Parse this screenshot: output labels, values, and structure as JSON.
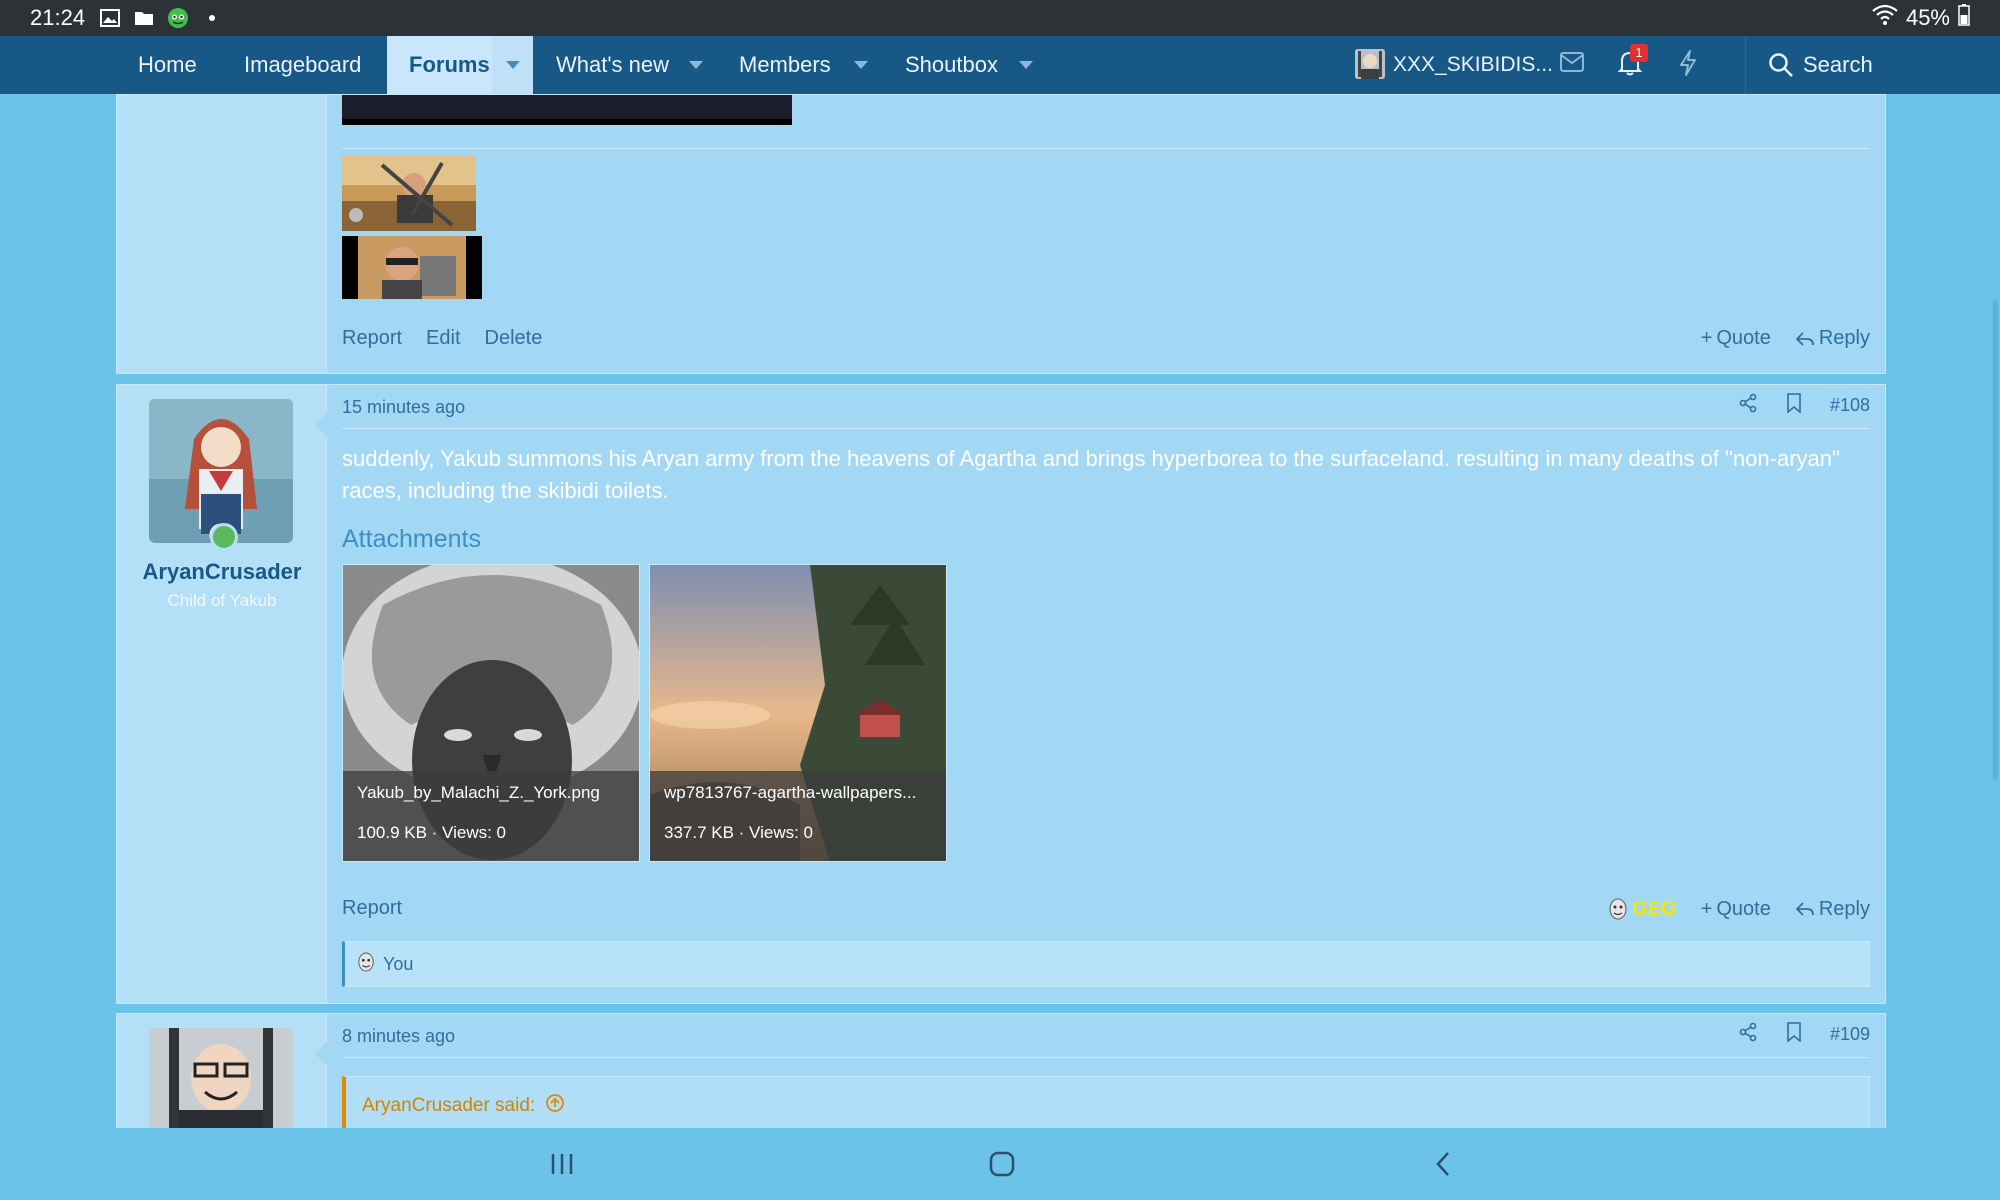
{
  "status_bar": {
    "time": "21:24",
    "icons": [
      "gallery-icon",
      "folder-icon",
      "app-icon",
      "dot-icon"
    ],
    "battery": "45%"
  },
  "nav": {
    "items": [
      {
        "label": "Home"
      },
      {
        "label": "Imageboard"
      },
      {
        "label": "Forums",
        "active": true
      },
      {
        "label": "What's new"
      },
      {
        "label": "Members"
      },
      {
        "label": "Shoutbox"
      }
    ],
    "username": "XXX_SKIBIDIS...",
    "alerts_badge": "1",
    "search_label": "Search"
  },
  "post_top": {
    "actions_left": [
      "Report",
      "Edit",
      "Delete"
    ],
    "quote_label": "Quote",
    "reply_label": "Reply"
  },
  "post_108": {
    "time": "15 minutes ago",
    "number": "#108",
    "author": "AryanCrusader",
    "user_title": "Child of Yakub",
    "body": "suddenly, Yakub summons his Aryan army from the heavens of Agartha and brings hyperborea to the surfaceland. resulting in many deaths of \"non-aryan\" races, including the skibidi toilets.",
    "attachments_heading": "Attachments",
    "attachments": [
      {
        "filename": "Yakub_by_Malachi_Z._York.png",
        "stats": "100.9 KB · Views: 0"
      },
      {
        "filename": "wp7813767-agartha-wallpapers...",
        "stats": "337.7 KB · Views: 0"
      }
    ],
    "report_label": "Report",
    "reaction_label": "GEG",
    "quote_label": "Quote",
    "reply_label": "Reply",
    "reacted_by": "You"
  },
  "post_109": {
    "time": "8 minutes ago",
    "number": "#109",
    "quote_author": "AryanCrusader said:"
  },
  "colors": {
    "nav_bg": "#185886",
    "page_bg": "#6cc3ea",
    "post_bg": "#a3d8f4",
    "link": "#2e6f9c",
    "reaction_yellow": "#f5e60a",
    "quote_orange": "#e28a00"
  }
}
